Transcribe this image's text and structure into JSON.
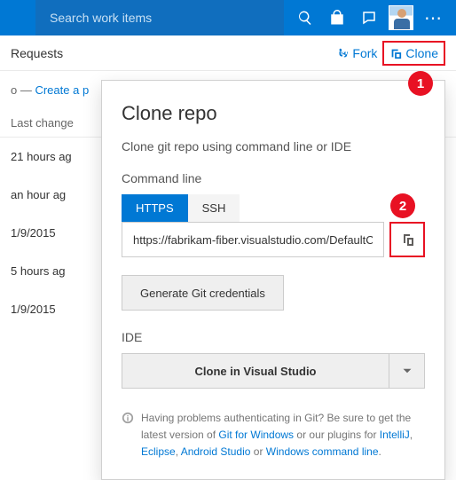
{
  "topbar": {
    "search_placeholder": "Search work items"
  },
  "subbar": {
    "title": "Requests",
    "fork": "Fork",
    "clone": "Clone"
  },
  "breadcrumb": {
    "prefix": "o — ",
    "link": "Create a p"
  },
  "list": {
    "header": "Last change",
    "rows": [
      "21 hours ag",
      "an hour ag",
      "1/9/2015",
      "5 hours ag",
      "1/9/2015"
    ]
  },
  "popup": {
    "title": "Clone repo",
    "subtitle": "Clone git repo using command line or IDE",
    "cmd_label": "Command line",
    "tab_https": "HTTPS",
    "tab_ssh": "SSH",
    "url": "https://fabrikam-fiber.visualstudio.com/DefaultColl...",
    "gen_creds": "Generate Git credentials",
    "ide_label": "IDE",
    "ide_button": "Clone in Visual Studio",
    "help_pre": "Having problems authenticating in Git? Be sure to get the latest version of ",
    "help_link1": "Git for Windows",
    "help_mid1": " or our plugins for ",
    "help_link2": "IntelliJ",
    "help_sep1": ", ",
    "help_link3": "Eclipse",
    "help_sep2": ", ",
    "help_link4": "Android Studio",
    "help_mid2": " or ",
    "help_link5": "Windows command line",
    "help_end": "."
  },
  "callouts": {
    "one": "1",
    "two": "2"
  }
}
